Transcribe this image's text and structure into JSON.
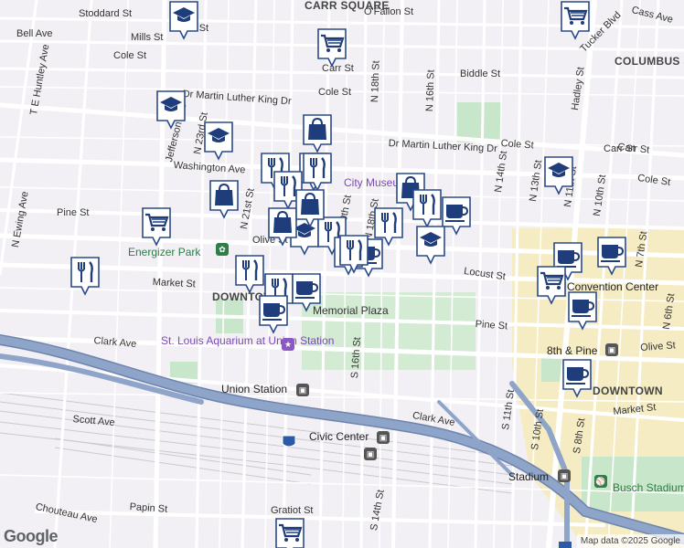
{
  "map": {
    "brand": "Google",
    "attribution": "Map data ©2025 Google",
    "colors": {
      "background": "#f2f0f4",
      "road": "#ffffff",
      "highway": "#8ea4c8",
      "highway_edge": "#6d84ad",
      "park": "#c8e6c9",
      "downtown": "#f6ecc4",
      "marker_fill": "#ffffff",
      "marker_stroke": "#2a4a8a",
      "icon": "#1f3d7a"
    },
    "street_labels": [
      "Stoddard St",
      "Bell Ave",
      "Mills St",
      "Cole St",
      "T E Huntley Ave",
      "Dr Martin Luther King Dr",
      "Dr Martin Luther King Dr",
      "Washington Ave",
      "Pine St",
      "N Ewing Ave",
      "Olive St",
      "Market St",
      "Clark Ave",
      "Scott Ave",
      "Chouteau Ave",
      "Papin St",
      "Gratiot St",
      "O'Fallon St",
      "Biddle St",
      "Carr St",
      "Cole St",
      "N 18th St",
      "N 16th St",
      "Cass Ave",
      "Tucker Blvd",
      "N 14th St",
      "N 13th St",
      "N 11th St",
      "N 10th St",
      "N 6th St",
      "N 7th St",
      "Hadley St",
      "Locust St",
      "Pine St",
      "Olive St",
      "Market St",
      "Clark Ave",
      "S 16th St",
      "S 14th St",
      "S 11th St",
      "S 10th St",
      "S 8th St",
      "Carr St",
      "Cole St",
      "N 21st St",
      "N 23rd St",
      "Jefferson Ave",
      "Cole St",
      "Arr St",
      "N 20th St",
      "N 18th St",
      "Carr St"
    ],
    "place_labels": {
      "columbus_square": "COLUMBUS SQUARE",
      "downtown": "DOWNTOWN",
      "downtown_west": "DOWNTOWN WEST",
      "carr_square": "CARR SQUARE",
      "energizer_park": "Energizer Park",
      "aquarium": "St. Louis Aquarium at Union Station",
      "union_station": "Union Station",
      "civic_center": "Civic Center",
      "stadium": "Stadium",
      "busch_stadium": "Busch Stadium",
      "convention_center": "Convention Center",
      "eighth_pine": "8th & Pine",
      "memorial_plaza": "Memorial Plaza",
      "city_museum": "City Museum",
      "i64": "64"
    },
    "markers": [
      {
        "type": "school-icon"
      },
      {
        "type": "grocery-icon"
      },
      {
        "type": "grocery-icon"
      },
      {
        "type": "school-icon"
      },
      {
        "type": "school-icon"
      },
      {
        "type": "restaurant-icon"
      },
      {
        "type": "restaurant-icon"
      },
      {
        "type": "restaurant-icon"
      },
      {
        "type": "shopping-icon"
      },
      {
        "type": "shopping-icon"
      },
      {
        "type": "shopping-icon"
      },
      {
        "type": "grocery-icon"
      },
      {
        "type": "restaurant-icon"
      },
      {
        "type": "school-icon"
      },
      {
        "type": "restaurant-icon"
      },
      {
        "type": "coffee-icon"
      },
      {
        "type": "restaurant-icon"
      },
      {
        "type": "restaurant-icon"
      },
      {
        "type": "restaurant-icon"
      },
      {
        "type": "coffee-icon"
      },
      {
        "type": "coffee-icon"
      },
      {
        "type": "shopping-icon"
      },
      {
        "type": "restaurant-icon"
      },
      {
        "type": "shopping-icon"
      },
      {
        "type": "coffee-icon"
      },
      {
        "type": "school-icon"
      },
      {
        "type": "school-icon"
      },
      {
        "type": "coffee-icon"
      },
      {
        "type": "coffee-icon"
      },
      {
        "type": "grocery-icon"
      },
      {
        "type": "coffee-icon"
      },
      {
        "type": "coffee-icon"
      },
      {
        "type": "grocery-icon"
      },
      {
        "type": "shopping-icon"
      },
      {
        "type": "restaurant-icon"
      },
      {
        "type": "restaurant-icon"
      }
    ]
  }
}
